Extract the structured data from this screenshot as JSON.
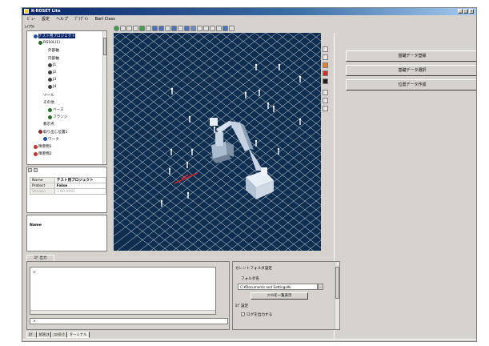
{
  "window": {
    "title": "K-ROSET Lite",
    "buttons": [
      "_",
      "□",
      "×"
    ]
  },
  "menu": [
    "ﾋﾞｭｰ",
    "設定",
    "ヘルプ",
    "ﾌﾟﾗｸﾞｲﾝ",
    "Bart Class"
  ],
  "layout_label": "ﾚｲｱｳﾄ",
  "tree": {
    "items": [
      {
        "label": "テスト用プロジェクト",
        "indent": 1,
        "icon": "#1f4fa0",
        "selected": true
      },
      {
        "label": "RS10L(1)",
        "indent": 2,
        "icon": "#2a6a2a"
      },
      {
        "label": "外部軸",
        "indent": 3,
        "icon": ""
      },
      {
        "label": "内部軸",
        "indent": 3,
        "icon": ""
      },
      {
        "label": "J1",
        "indent": 4,
        "icon": "#404040"
      },
      {
        "label": "J2",
        "indent": 4,
        "icon": "#404040"
      },
      {
        "label": "J3",
        "indent": 4,
        "icon": "#404040"
      },
      {
        "label": "J4",
        "indent": 4,
        "icon": "#404040"
      },
      {
        "label": "ツール",
        "indent": 2,
        "icon": ""
      },
      {
        "label": "その他",
        "indent": 2,
        "icon": ""
      },
      {
        "label": "ベース",
        "indent": 4,
        "icon": "#2a6a2a"
      },
      {
        "label": "フランジ",
        "indent": 4,
        "icon": "#2a6a2a"
      },
      {
        "label": "教示点",
        "indent": 2,
        "icon": ""
      },
      {
        "label": "取り出し位置1",
        "indent": 2,
        "icon": "#8a2a2a"
      },
      {
        "label": "ワーク",
        "indent": 3,
        "icon": "#1f4fa0"
      },
      {
        "label": "障害物1",
        "indent": 1,
        "icon": "#c03030"
      },
      {
        "label": "障害物2",
        "indent": 1,
        "icon": "#c03030"
      }
    ]
  },
  "properties": {
    "rows": [
      {
        "key": "Name",
        "value": "テスト用プロジェクト",
        "dim": false
      },
      {
        "key": "Protect",
        "value": "False",
        "dim": false
      },
      {
        "key": "Version",
        "value": "1.00.0001",
        "dim": true
      }
    ]
  },
  "name_panel": {
    "label": "Name"
  },
  "right_buttons": [
    "基礎データ登録",
    "基礎データ選択",
    "位置データ作成"
  ],
  "output": {
    "tab": "ﾛｸﾞ出力",
    "prompt": ">",
    "command": ">"
  },
  "config": {
    "current_label": "カレントフォルダ設定",
    "folder_label": "フォルダ名",
    "folder_value": "C:¥Documents and Settings¥k",
    "list_button": "ﾌｧｲﾙを一覧表示",
    "log_label": "ﾛｸﾞ設定",
    "log_checkbox": "ログを出力する"
  },
  "bottom_tabs": [
    "ﾛｸﾞ",
    "I/Oﾓﾆﾀ",
    "ｺﾝﾄﾛｰﾗ",
    "ターミナル"
  ],
  "colors": {
    "title_start": "#0a246a",
    "view_bg": "#0f2d4f",
    "grid": "#dfe7ee",
    "robot": "#c9d6e6"
  }
}
